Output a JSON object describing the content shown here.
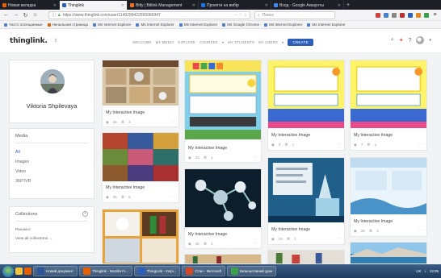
{
  "browser": {
    "tabs": [
      {
        "label": "Новая вкладка",
        "active": false,
        "color": "#e66000"
      },
      {
        "label": "Thinglink",
        "active": true,
        "color": "#2c5fb8"
      },
      {
        "label": "Bitly | Bitlink Management",
        "active": false,
        "color": "#f26f21"
      },
      {
        "label": "Проекти на вибір",
        "active": false,
        "color": "#1a73e8"
      },
      {
        "label": "Вход - Google Аккаунты",
        "active": false,
        "color": "#4285f4"
      }
    ],
    "new_tab_glyph": "+",
    "url": "https://www.thinglink.com/user/1149299422555066947",
    "page_actions": "··· ♡ ☆",
    "search_placeholder": "Поиск",
    "bookmarks": [
      "Часто посещаемые",
      "Начальная страница",
      "Ms Internet Explorer",
      "Ms Internet Explorer",
      "Ms Internet Explorer",
      "Ms Google Chrome",
      "Ms Internet Explorer",
      "Ms Internet Explorer"
    ]
  },
  "site": {
    "logo": "thinglink.",
    "nav": [
      "WELCOME",
      "MY MEDIA",
      "EXPLORE",
      "COURSES",
      "MY STUDENTS",
      "MY USERS"
    ],
    "create_label": "CREATE"
  },
  "profile": {
    "name": "Viktoria Shpilevaya"
  },
  "media": {
    "title": "Media",
    "items": [
      "All",
      "Images",
      "Video",
      "360°/VR"
    ]
  },
  "collections": {
    "title": "Collections",
    "add_glyph": "+",
    "items": [
      "Ранокінт",
      "View all collections →"
    ]
  },
  "grid": {
    "cards": [
      {
        "title": "My Interactive Image",
        "views": "26",
        "tags": "3",
        "thumb": "kitchen"
      },
      {
        "title": "My Interactive Image",
        "views": "23",
        "tags": "1",
        "thumb": "colorful-board"
      },
      {
        "title": "My Interactive Image",
        "views": "3",
        "tags": "1",
        "thumb": "yellow-board"
      },
      {
        "title": "My Interactive Image",
        "views": "7",
        "tags": "1",
        "thumb": "yellow-board-2"
      },
      {
        "title": "My Interactive Image",
        "views": "36",
        "tags": "6",
        "thumb": "collage"
      },
      {
        "title": "My Interactive Image",
        "views": "25",
        "tags": "1",
        "thumb": "molecule"
      },
      {
        "title": "My Interactive Image",
        "views": "24",
        "tags": "1",
        "thumb": "lab"
      },
      {
        "title": "My Interactive Image",
        "views": "26",
        "tags": "3",
        "thumb": "water-map"
      },
      {
        "title": "",
        "views": "",
        "tags": "",
        "thumb": "household"
      },
      {
        "title": "",
        "views": "",
        "tags": "",
        "thumb": "bottles"
      },
      {
        "title": "",
        "views": "",
        "tags": "",
        "thumb": "products"
      },
      {
        "title": "",
        "views": "",
        "tags": "",
        "thumb": "coast"
      }
    ]
  },
  "taskbar": {
    "items": [
      "Новий документ",
      "Thinglink - Mozilla Fi...",
      "ThingLink - Inspi...",
      "Стан - Microsoft",
      "Безкоштовний урок",
      "Інша вкладка"
    ],
    "lang": "UK",
    "time": "13:05"
  },
  "colors": {
    "brand": "#2c5fb8",
    "page_bg": "#f2f3f5"
  }
}
